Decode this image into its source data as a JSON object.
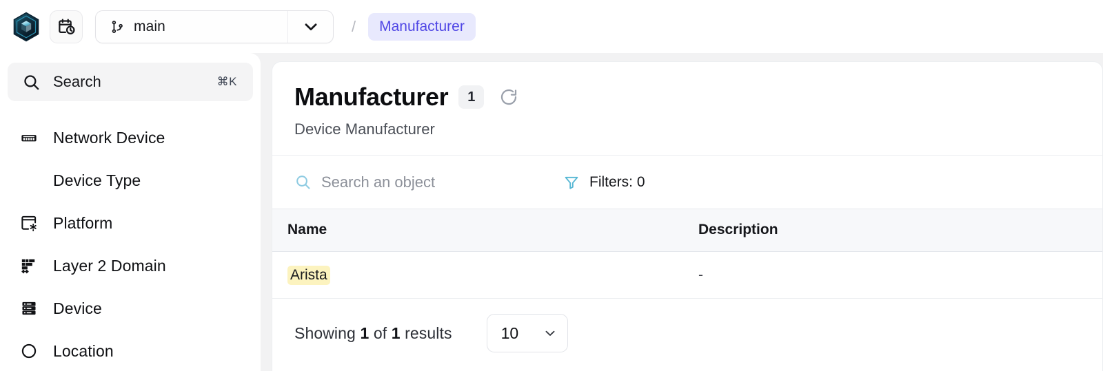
{
  "topbar": {
    "logo_icon": "infrahub-cube-logo",
    "history_button": {
      "icon": "calendar-clock-icon",
      "label": ""
    },
    "branch": {
      "icon": "git-branch-icon",
      "value": "main",
      "caret_icon": "chevron-down-icon"
    },
    "breadcrumb": {
      "separator": "/",
      "current": "Manufacturer"
    }
  },
  "sidebar": {
    "search": {
      "icon": "search-icon",
      "label": "Search",
      "shortcut": "⌘K"
    },
    "items": [
      {
        "label": "Network Device",
        "icon": "switch-icon",
        "sub": false
      },
      {
        "label": "Device Type",
        "icon": "",
        "sub": true
      },
      {
        "label": "Platform",
        "icon": "window-settings-icon",
        "sub": false
      },
      {
        "label": "Layer 2 Domain",
        "icon": "layer2-icon",
        "sub": false
      },
      {
        "label": "Device",
        "icon": "server-icon",
        "sub": false
      },
      {
        "label": "Location",
        "icon": "location-pin-icon",
        "sub": false
      }
    ]
  },
  "main": {
    "title": "Manufacturer",
    "count": "1",
    "refresh_icon": "refresh-icon",
    "subtitle": "Device Manufacturer",
    "toolbar": {
      "search_icon": "search-icon",
      "search_placeholder": "Search an object",
      "search_value": "",
      "filter_icon": "filter-icon",
      "filters_label": "Filters: 0"
    },
    "table": {
      "columns": [
        "Name",
        "Description"
      ],
      "rows": [
        {
          "name": "Arista",
          "name_highlighted": true,
          "description": "-"
        }
      ]
    },
    "footer": {
      "showing_prefix": "Showing",
      "showing_count": "1",
      "showing_mid": "of",
      "showing_total": "1",
      "showing_suffix": "results",
      "page_size": "10",
      "page_size_caret": "chevron-down-icon"
    }
  },
  "colors": {
    "accent_indigo": "#4f46e5",
    "breadcrumb_bg": "#e8e9fd",
    "highlight_yellow": "#fcf3bf",
    "icon_teal": "#7ec8e0",
    "panel_border": "#eceef1",
    "table_header_bg": "#f7f8fa",
    "app_bg": "#f2f2f3"
  }
}
